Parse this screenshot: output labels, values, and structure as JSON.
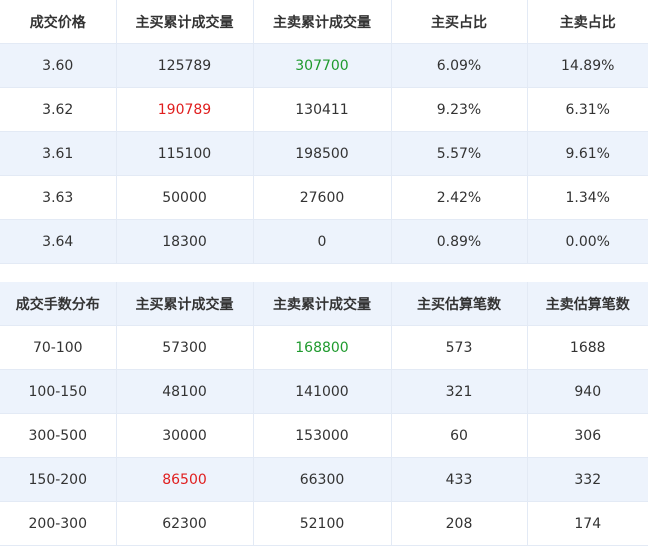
{
  "price_table": {
    "headers": [
      "成交价格",
      "主买累计成交量",
      "主卖累计成交量",
      "主买占比",
      "主卖占比"
    ],
    "rows": [
      [
        "3.60",
        "125789",
        "307700",
        "6.09%",
        "14.89%"
      ],
      [
        "3.62",
        "190789",
        "130411",
        "9.23%",
        "6.31%"
      ],
      [
        "3.61",
        "115100",
        "198500",
        "5.57%",
        "9.61%"
      ],
      [
        "3.63",
        "50000",
        "27600",
        "2.42%",
        "1.34%"
      ],
      [
        "3.64",
        "18300",
        "0",
        "0.89%",
        "0.00%"
      ]
    ]
  },
  "lot_table": {
    "headers": [
      "成交手数分布",
      "主买累计成交量",
      "主卖累计成交量",
      "主买估算笔数",
      "主卖估算笔数"
    ],
    "rows": [
      [
        "70-100",
        "57300",
        "168800",
        "573",
        "1688"
      ],
      [
        "100-150",
        "48100",
        "141000",
        "321",
        "940"
      ],
      [
        "300-500",
        "30000",
        "153000",
        "60",
        "306"
      ],
      [
        "150-200",
        "86500",
        "66300",
        "433",
        "332"
      ],
      [
        "200-300",
        "62300",
        "52100",
        "208",
        "174"
      ]
    ]
  },
  "colors": {
    "highlight_red": "#e01e1e",
    "highlight_green": "#1f9a2e",
    "stripe": "#edf3fc",
    "border": "#e3eaf5"
  }
}
